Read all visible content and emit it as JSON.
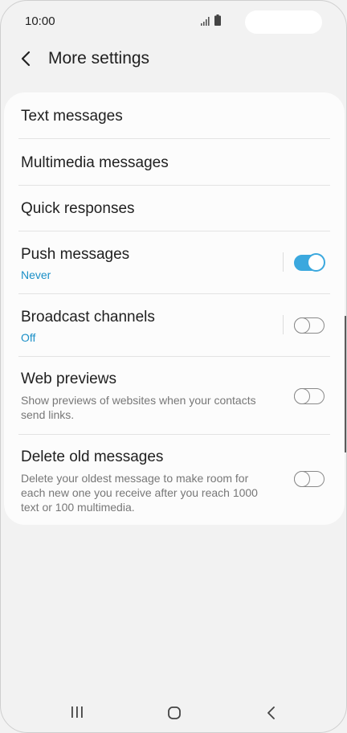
{
  "status_bar": {
    "time": "10:00",
    "icons": [
      "signal-icon",
      "battery-icon"
    ]
  },
  "header": {
    "title": "More settings",
    "back_icon": "back-arrow-icon"
  },
  "settings": [
    {
      "title": "Text messages"
    },
    {
      "title": "Multimedia messages"
    },
    {
      "title": "Quick responses"
    },
    {
      "title": "Push messages",
      "subtitle": "Never",
      "toggle": true,
      "toggle_on": true
    },
    {
      "title": "Broadcast channels",
      "subtitle": "Off",
      "toggle": true,
      "toggle_on": false
    },
    {
      "title": "Web previews",
      "description": "Show previews of websites when your contacts send links.",
      "toggle": true,
      "toggle_on": false
    },
    {
      "title": "Delete old messages",
      "description": "Delete your oldest message to make room for each new one you receive after you reach 1000 text or 100 multimedia.",
      "toggle": true,
      "toggle_on": false
    }
  ],
  "nav_bar": {
    "icons": [
      "recent-apps-icon",
      "home-icon",
      "back-icon"
    ]
  },
  "colors": {
    "accent": "#3ba8de",
    "subtitle_blue": "#1a8fc7",
    "background": "#f2f2f2",
    "card": "#fcfcfc"
  }
}
